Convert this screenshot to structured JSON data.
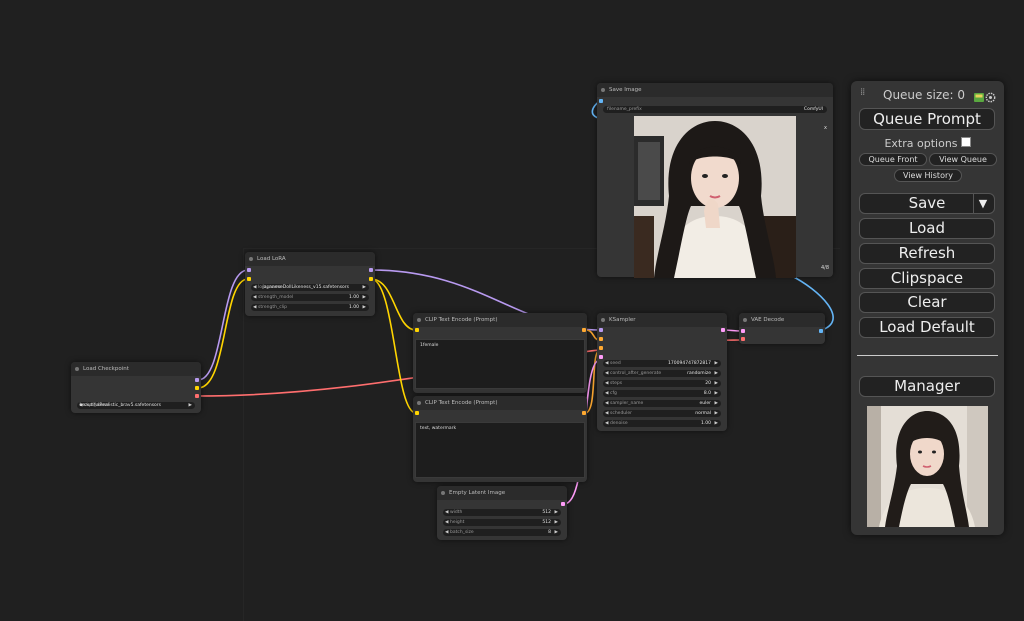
{
  "nodes": {
    "load_checkpoint": {
      "title": "Load Checkpoint",
      "ckpt_label": "ckpt_name",
      "ckpt_value": "beautifulRealistic_brav5.safetensors"
    },
    "load_lora": {
      "title": "Load LoRA",
      "lora_label": "lora_name",
      "lora_value": "japaneseDollLikeness_v15.safetensors",
      "strength_model_label": "strength_model",
      "strength_model_value": "1.00",
      "strength_clip_label": "strength_clip",
      "strength_clip_value": "1.00"
    },
    "clip_positive": {
      "title": "CLIP Text Encode (Prompt)",
      "text": "1female"
    },
    "clip_negative": {
      "title": "CLIP Text Encode (Prompt)",
      "text": "text, watermark"
    },
    "empty_latent": {
      "title": "Empty Latent Image",
      "width_label": "width",
      "width_value": "512",
      "height_label": "height",
      "height_value": "512",
      "batch_label": "batch_size",
      "batch_value": "8"
    },
    "ksampler": {
      "title": "KSampler",
      "rows": [
        {
          "label": "seed",
          "value": "170094747872817"
        },
        {
          "label": "control_after_generate",
          "value": "randomize"
        },
        {
          "label": "steps",
          "value": "20"
        },
        {
          "label": "cfg",
          "value": "8.0"
        },
        {
          "label": "sampler_name",
          "value": "euler"
        },
        {
          "label": "scheduler",
          "value": "normal"
        },
        {
          "label": "denoise",
          "value": "1.00"
        }
      ]
    },
    "vae_decode": {
      "title": "VAE Decode"
    },
    "save_image": {
      "title": "Save Image",
      "prefix_label": "filename_prefix",
      "prefix_value": "ComfyUI",
      "close": "x",
      "counter": "4/8"
    }
  },
  "panel": {
    "queue_size": "Queue size: 0",
    "queue_prompt": "Queue Prompt",
    "extra_options": "Extra options",
    "queue_front": "Queue Front",
    "view_queue": "View Queue",
    "view_history": "View History",
    "save": "Save",
    "save_dropdown": "▼",
    "load": "Load",
    "refresh": "Refresh",
    "clipspace": "Clipspace",
    "clear": "Clear",
    "load_default": "Load Default",
    "manager": "Manager",
    "icons": [
      "image-icon",
      "settings-icon"
    ]
  },
  "colors": {
    "model": "#b89af0",
    "clip": "#ffd500",
    "vae": "#ff6e6e",
    "conditioning": "#ffa931",
    "latent": "#ff9cf9",
    "image": "#64b5f6"
  }
}
